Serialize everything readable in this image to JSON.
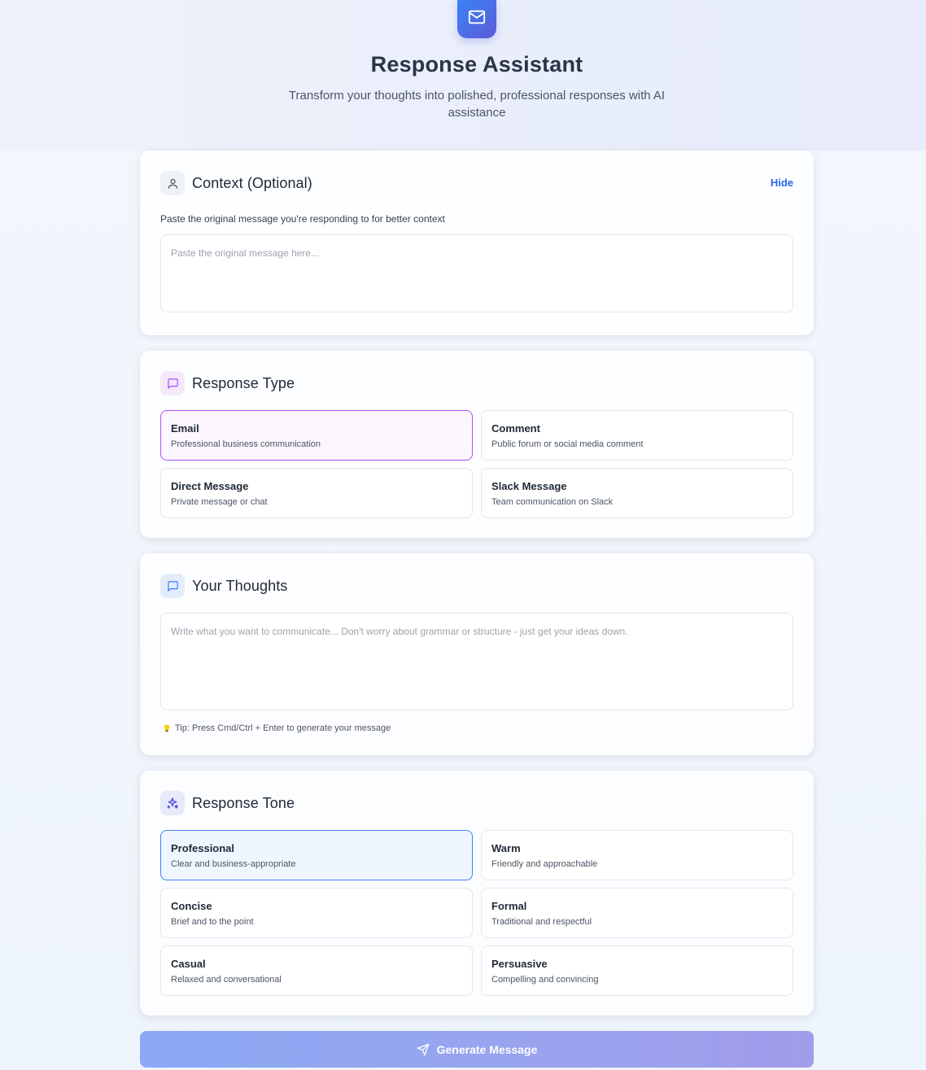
{
  "header": {
    "icon": "mail-icon",
    "title": "Response Assistant",
    "subtitle": "Transform your thoughts into polished, professional responses with AI assistance"
  },
  "context": {
    "icon": "user-icon",
    "title": "Context (Optional)",
    "hide_label": "Hide",
    "description": "Paste the original message you're responding to for better context",
    "placeholder": "Paste the original message here...",
    "value": ""
  },
  "response_type": {
    "icon": "message-square-icon",
    "title": "Response Type",
    "selected": "Email",
    "options": [
      {
        "label": "Email",
        "description": "Professional business communication"
      },
      {
        "label": "Comment",
        "description": "Public forum or social media comment"
      },
      {
        "label": "Direct Message",
        "description": "Private message or chat"
      },
      {
        "label": "Slack Message",
        "description": "Team communication on Slack"
      }
    ]
  },
  "thoughts": {
    "icon": "message-square-icon",
    "title": "Your Thoughts",
    "placeholder": "Write what you want to communicate... Don't worry about grammar or structure - just get your ideas down.",
    "value": "",
    "tip_icon": "lightbulb-icon",
    "tip": "Tip: Press Cmd/Ctrl + Enter to generate your message"
  },
  "tone": {
    "icon": "sparkles-icon",
    "title": "Response Tone",
    "selected": "Professional",
    "options": [
      {
        "label": "Professional",
        "description": "Clear and business-appropriate"
      },
      {
        "label": "Warm",
        "description": "Friendly and approachable"
      },
      {
        "label": "Concise",
        "description": "Brief and to the point"
      },
      {
        "label": "Formal",
        "description": "Traditional and respectful"
      },
      {
        "label": "Casual",
        "description": "Relaxed and conversational"
      },
      {
        "label": "Persuasive",
        "description": "Compelling and convincing"
      }
    ]
  },
  "generate": {
    "icon": "send-icon",
    "label": "Generate Message"
  },
  "colors": {
    "accent_blue": "#3b82f6",
    "accent_purple": "#a855f7",
    "link": "#2563eb",
    "button_gradient_start": "#8ba9f4",
    "button_gradient_end": "#a19deb"
  }
}
